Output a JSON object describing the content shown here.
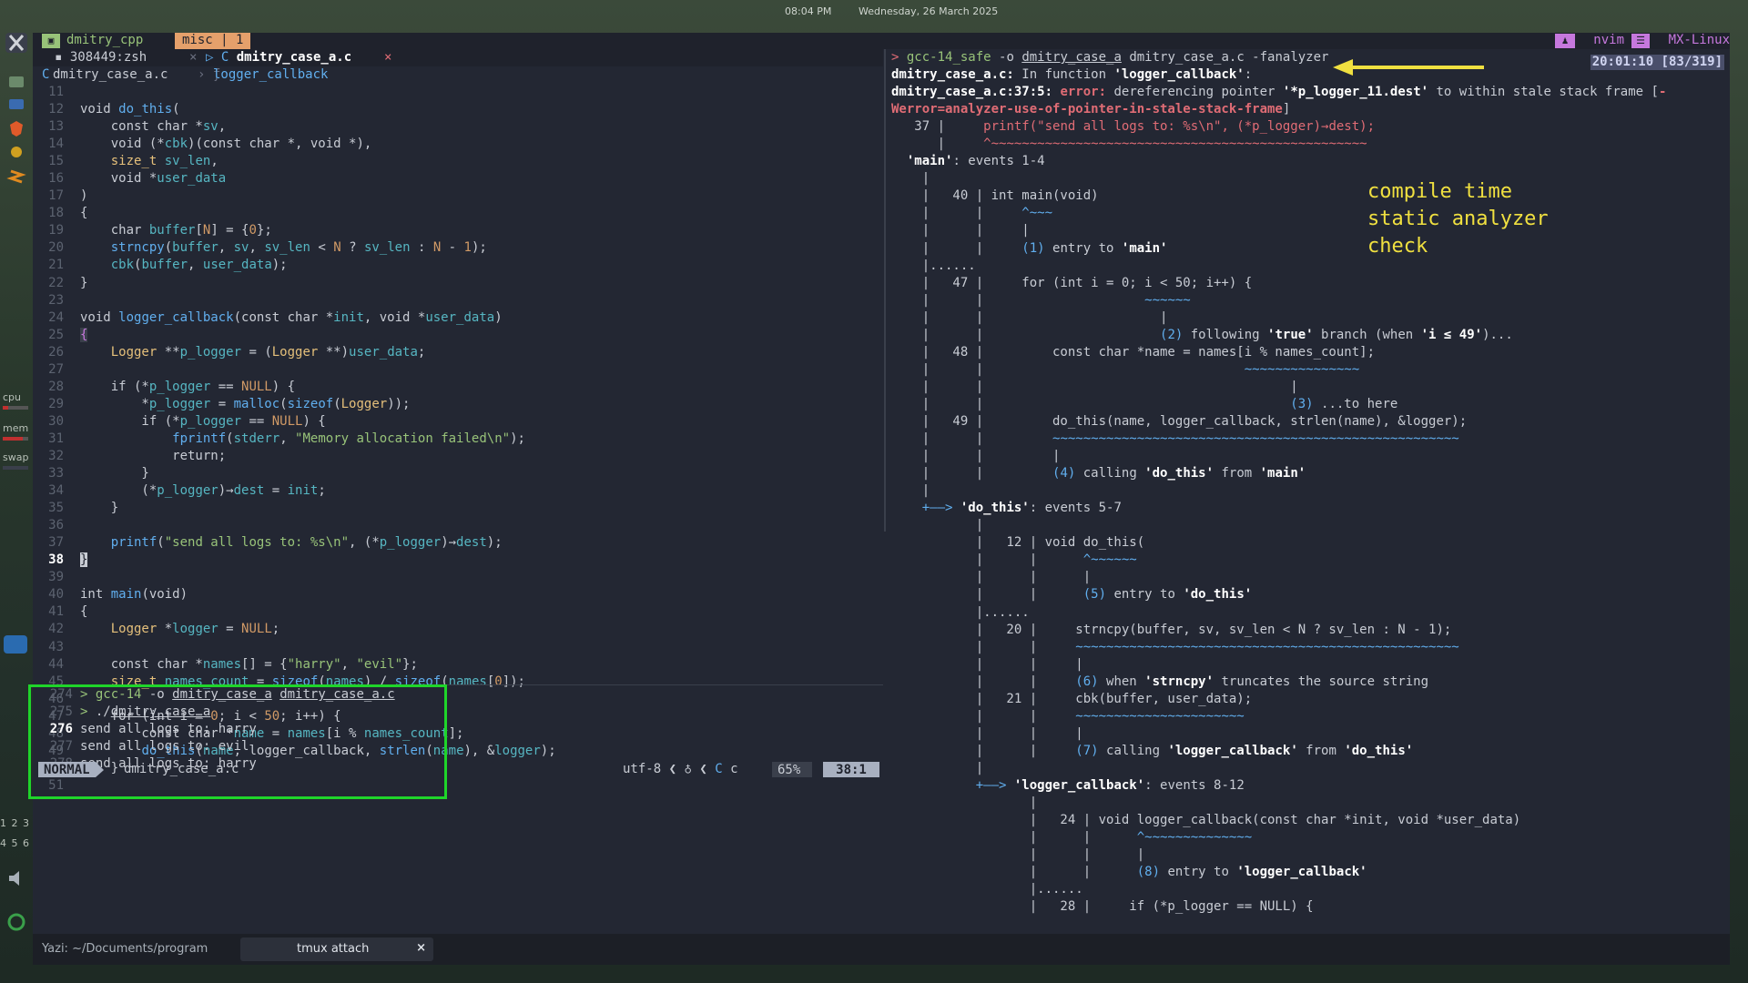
{
  "topbar": {
    "time": "08:04 PM",
    "date": "Wednesday, 26 March 2025"
  },
  "dock": {
    "cpu": "cpu",
    "mem": "mem",
    "swap": "swap",
    "ws1": "1 2 3",
    "ws2": "4 5 6"
  },
  "tmux": {
    "session": "dmitry_cpp",
    "window": "misc | 1",
    "right_app": "nvim",
    "right_host": "MX-Linux",
    "clock": "20:01:10 [83/319]"
  },
  "nvim": {
    "tab1": "308449:zsh",
    "tab2": "dmitry_case_a.c",
    "winbar_file": "dmitry_case_a.c",
    "winbar_fn": "logger_callback",
    "mode": "NORMAL",
    "status_file": "dmitry_case_a.c",
    "encoding": "utf-8",
    "filetype": "c",
    "percent": "65%",
    "position": "38:1"
  },
  "code_lines": [
    {
      "n": "11",
      "t": ""
    },
    {
      "n": "12",
      "t": "void do_this("
    },
    {
      "n": "13",
      "t": "    const char *sv,"
    },
    {
      "n": "14",
      "t": "    void (*cbk)(const char *, void *),"
    },
    {
      "n": "15",
      "t": "    size_t sv_len,"
    },
    {
      "n": "16",
      "t": "    void *user_data"
    },
    {
      "n": "17",
      "t": ")"
    },
    {
      "n": "18",
      "t": "{"
    },
    {
      "n": "19",
      "t": "    char buffer[N] = {0};"
    },
    {
      "n": "20",
      "t": "    strncpy(buffer, sv, sv_len < N ? sv_len : N - 1);"
    },
    {
      "n": "21",
      "t": "    cbk(buffer, user_data);"
    },
    {
      "n": "22",
      "t": "}"
    },
    {
      "n": "23",
      "t": ""
    },
    {
      "n": "24",
      "t": "void logger_callback(const char *init, void *user_data)"
    },
    {
      "n": "25",
      "t": "{"
    },
    {
      "n": "26",
      "t": "    Logger **p_logger = (Logger **)user_data;"
    },
    {
      "n": "27",
      "t": ""
    },
    {
      "n": "28",
      "t": "    if (*p_logger == NULL) {"
    },
    {
      "n": "29",
      "t": "        *p_logger = malloc(sizeof(Logger));"
    },
    {
      "n": "30",
      "t": "        if (*p_logger == NULL) {"
    },
    {
      "n": "31",
      "t": "            fprintf(stderr, \"Memory allocation failed\\n\");"
    },
    {
      "n": "32",
      "t": "            return;"
    },
    {
      "n": "33",
      "t": "        }"
    },
    {
      "n": "34",
      "t": "        (*p_logger)→dest = init;"
    },
    {
      "n": "35",
      "t": "    }"
    },
    {
      "n": "36",
      "t": ""
    },
    {
      "n": "37",
      "t": "    printf(\"send all logs to: %s\\n\", (*p_logger)→dest);"
    },
    {
      "n": "38",
      "t": "}"
    },
    {
      "n": "39",
      "t": ""
    },
    {
      "n": "40",
      "t": "int main(void)"
    },
    {
      "n": "41",
      "t": "{"
    },
    {
      "n": "42",
      "t": "    Logger *logger = NULL;"
    },
    {
      "n": "43",
      "t": ""
    },
    {
      "n": "44",
      "t": "    const char *names[] = {\"harry\", \"evil\"};"
    },
    {
      "n": "45",
      "t": "    size_t names_count = sizeof(names) / sizeof(names[0]);"
    },
    {
      "n": "46",
      "t": ""
    },
    {
      "n": "47",
      "t": "    for (int i = 0; i < 50; i++) {"
    },
    {
      "n": "48",
      "t": "        const char *name = names[i % names_count];"
    },
    {
      "n": "49",
      "t": "        do_this(name, logger_callback, strlen(name), &logger);"
    },
    {
      "n": "50",
      "t": "    }"
    },
    {
      "n": "51",
      "t": ""
    }
  ],
  "shell_lines": [
    {
      "n": "274",
      "t": "> gcc-14 -o dmitry_case_a dmitry_case_a.c"
    },
    {
      "n": "275",
      "t": "> ./dmitry_case_a"
    },
    {
      "n": "276",
      "t": "send all logs to: harry"
    },
    {
      "n": "277",
      "t": "send all logs to: evil"
    },
    {
      "n": "278",
      "t": "send all logs to: harry"
    }
  ],
  "analyzer_lines": [
    "> gcc-14_safe -o dmitry_case_a dmitry_case_a.c -fanalyzer",
    "dmitry_case_a.c: In function 'logger_callback':",
    "dmitry_case_a.c:37:5: error: dereferencing pointer '*p_logger_11.dest' to within stale stack frame [-",
    "Werror=analyzer-use-of-pointer-in-stale-stack-frame]",
    "   37 |     printf(\"send all logs to: %s\\n\", (*p_logger)→dest);",
    "      |     ^~~~~~~~~~~~~~~~~~~~~~~~~~~~~~~~~~~~~~~~~~~~~~~~~~",
    "  'main': events 1-4",
    "    |",
    "    |   40 | int main(void)",
    "    |      |     ^~~~",
    "    |      |     |",
    "    |      |     (1) entry to 'main'",
    "    |......",
    "    |   47 |     for (int i = 0; i < 50; i++) {",
    "    |      |                     ~~~~~~",
    "    |      |                       |",
    "    |      |                       (2) following 'true' branch (when 'i ≤ 49')...",
    "    |   48 |         const char *name = names[i % names_count];",
    "    |      |                                  ~~~~~~~~~~~~~~~",
    "    |      |                                        |",
    "    |      |                                        (3) ...to here",
    "    |   49 |         do_this(name, logger_callback, strlen(name), &logger);",
    "    |      |         ~~~~~~~~~~~~~~~~~~~~~~~~~~~~~~~~~~~~~~~~~~~~~~~~~~~~~",
    "    |      |         |",
    "    |      |         (4) calling 'do_this' from 'main'",
    "    |",
    "    +——> 'do_this': events 5-7",
    "           |",
    "           |   12 | void do_this(",
    "           |      |      ^~~~~~~",
    "           |      |      |",
    "           |      |      (5) entry to 'do_this'",
    "           |......",
    "           |   20 |     strncpy(buffer, sv, sv_len < N ? sv_len : N - 1);",
    "           |      |     ~~~~~~~~~~~~~~~~~~~~~~~~~~~~~~~~~~~~~~~~~~~~~~~~~~",
    "           |      |     |",
    "           |      |     (6) when 'strncpy' truncates the source string",
    "           |   21 |     cbk(buffer, user_data);",
    "           |      |     ~~~~~~~~~~~~~~~~~~~~~~",
    "           |      |     |",
    "           |      |     (7) calling 'logger_callback' from 'do_this'",
    "           |",
    "           +——> 'logger_callback': events 8-12",
    "                  |",
    "                  |   24 | void logger_callback(const char *init, void *user_data)",
    "                  |      |      ^~~~~~~~~~~~~~~",
    "                  |      |      |",
    "                  |      |      (8) entry to 'logger_callback'",
    "                  |......",
    "                  |   28 |     if (*p_logger == NULL) {"
  ],
  "annotation": "compile time\nstatic analyzer\ncheck",
  "taskbar": {
    "item1": "Yazi: ~/Documents/program",
    "item2": "tmux attach",
    "item2_close": "×"
  },
  "colors": {
    "highlight_box": "#1fd52a",
    "annotation": "#f0e040",
    "error": "#e06c75"
  }
}
